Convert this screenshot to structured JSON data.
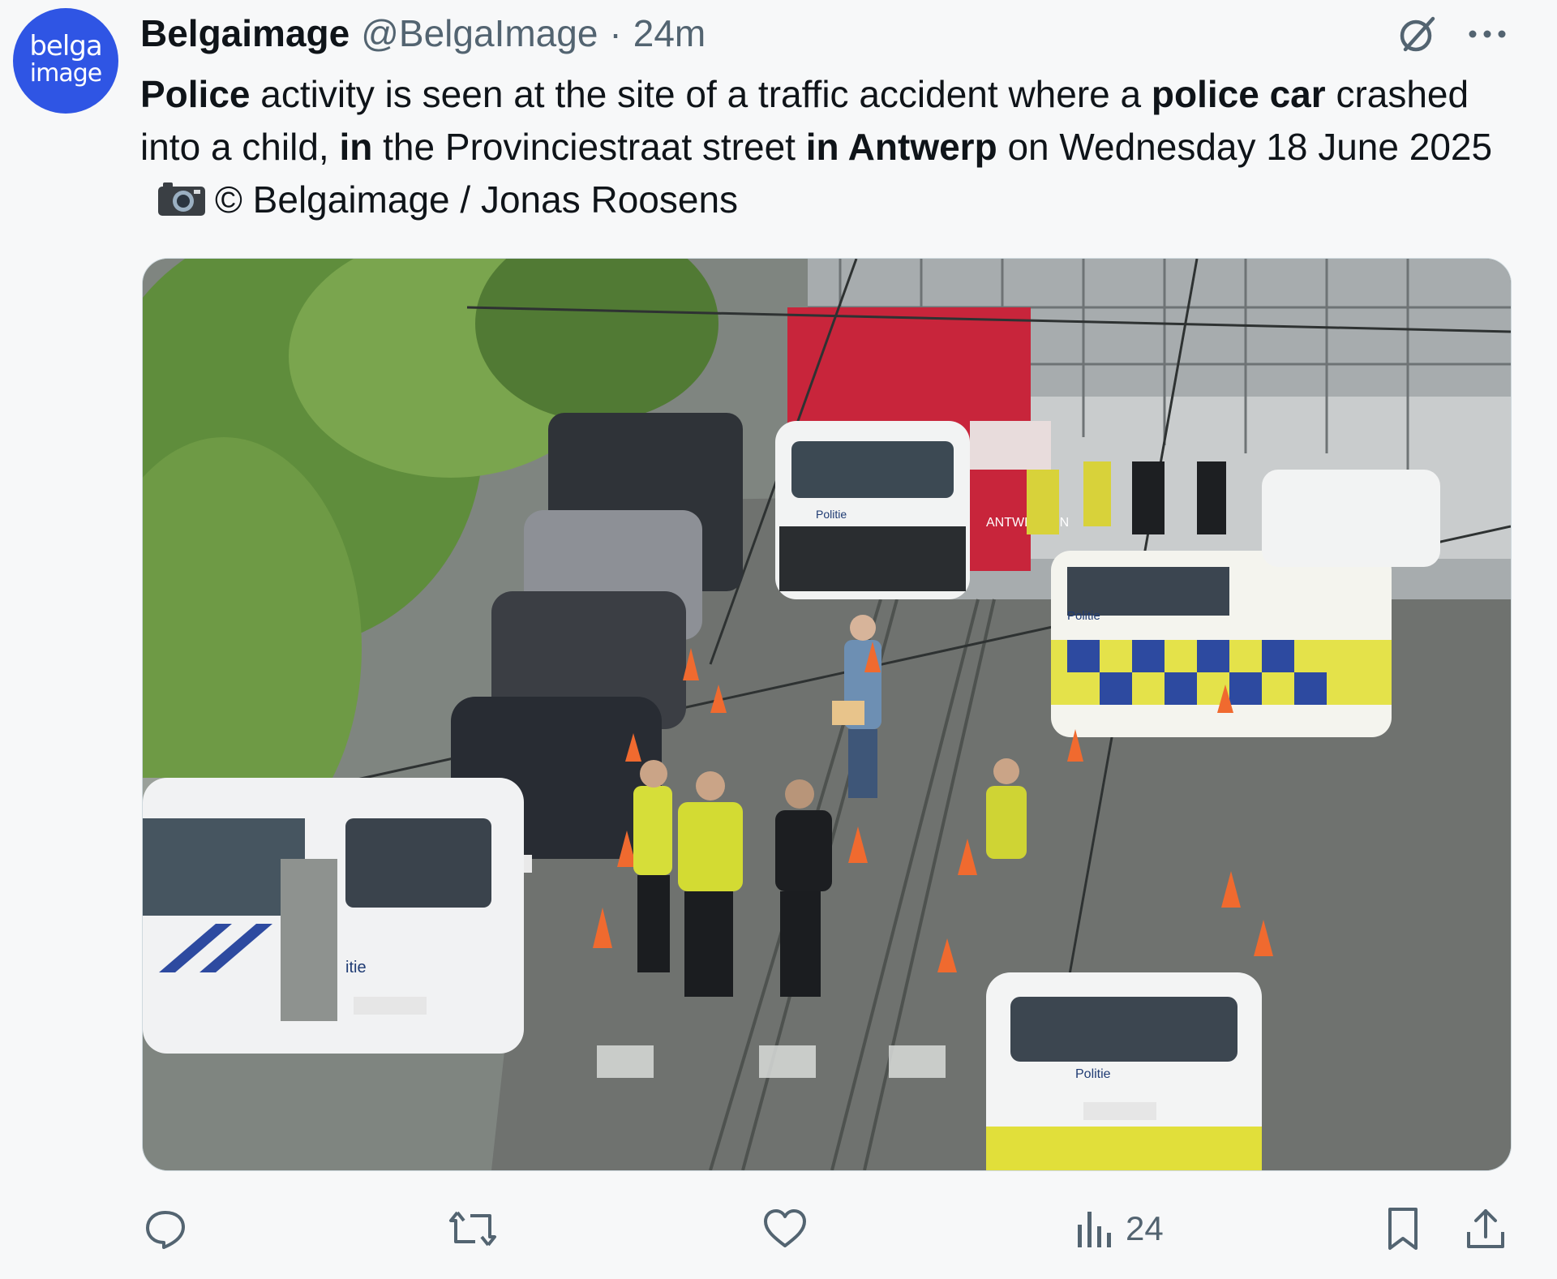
{
  "account": {
    "avatar_line1": "belga",
    "avatar_line2": "image",
    "display_name": "Belgaimage",
    "handle": "@BelgaImage",
    "separator": "·",
    "time": "24m"
  },
  "post": {
    "seg1_bold": "Police",
    "seg2": " activity is seen at the site of a traffic accident where a ",
    "seg3_bold": "police car",
    "seg4": " crashed into a child, ",
    "seg5_bold": "in",
    "seg6": " the Provinciestraat street ",
    "seg7_bold": "in Antwerp",
    "seg8": " on Wednesday 18 June 2025",
    "seg9": "© Belgaimage / Jonas Roosens"
  },
  "media": {
    "photo_text": {
      "van_label": "Politie",
      "tent_label": "ANTWERPEN",
      "van_right_label": "Politie",
      "van_left_label": "itie",
      "car_bottom_label": "Politie"
    }
  },
  "actions": {
    "views_count": "24"
  },
  "colors": {
    "accent": "#1d9bf0",
    "avatar_bg": "#2f55e4",
    "secondary_text": "#536471"
  },
  "icons": [
    "grok-icon",
    "more-icon",
    "camera-icon",
    "reply-icon",
    "repost-icon",
    "like-icon",
    "views-icon",
    "bookmark-icon",
    "share-icon"
  ]
}
